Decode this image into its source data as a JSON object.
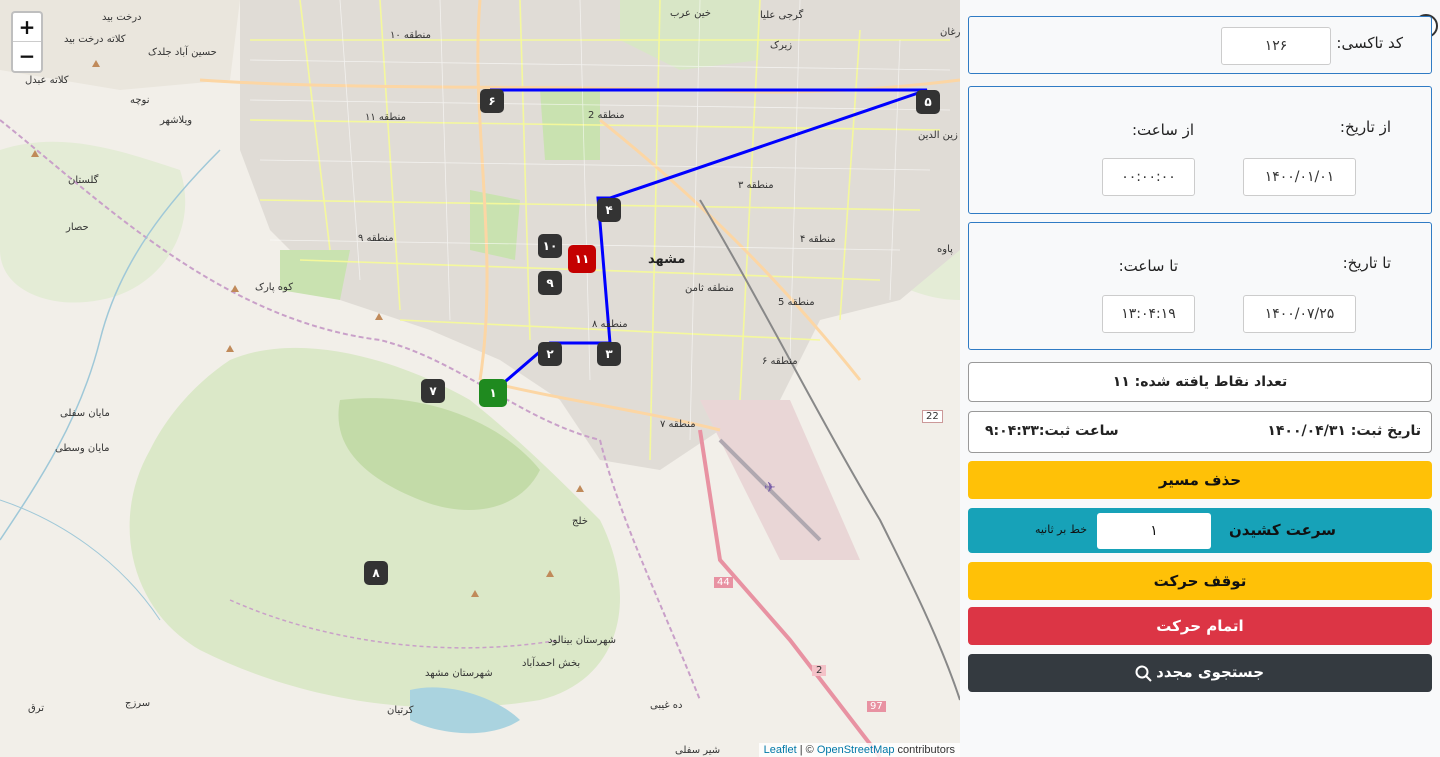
{
  "map": {
    "zoom_in_label": "+",
    "zoom_out_label": "−",
    "attribution": {
      "leaflet": "Leaflet",
      "separator": " | © ",
      "osm": "OpenStreetMap",
      "contributors": " contributors"
    },
    "labels": {
      "city": "مشهد",
      "d10": "منطقه ۱۰",
      "d2": "منطقه 2",
      "d11": "منطقه ۱۱",
      "d3": "منطقه ۳",
      "d4": "منطقه ۴",
      "d9": "منطقه ۹",
      "d5": "منطقه 5",
      "d6": "منطقه ۶",
      "d8": "منطقه ۸",
      "d7": "منطقه ۷",
      "thamen": "منطقه ثامن",
      "golestan": "گلستان",
      "hesar": "حصار",
      "kuhpark": "کوه پارک",
      "mayan_sofla": "مایان سفلی",
      "mayan_vosta": "مایان وسطی",
      "kalat": "کلاته عبدل",
      "vilashahr": "ویلاشهر",
      "noche": "نوچه",
      "khalaj": "خلج",
      "kartian": "کرتیان",
      "deh_ghibi": "ده غیبی",
      "sarzaj": "سرزج",
      "toroq": "ترق",
      "gorgi": "گرجی علیا",
      "zirak": "زیرک",
      "khin": "خین عرب",
      "zarghan": "زرغان",
      "zeinodin": "زین الدین",
      "pavia": "پاوه",
      "derakht_bid": "کلاته درخت بید",
      "hossein": "حسین آباد جلدک",
      "derakht": "درخت بید",
      "shir": "شیر سفلی",
      "toragh_r": "22",
      "hw44": "44",
      "hw2": "2",
      "hw97": "97",
      "binalud": "شهرستان بینالود",
      "ahmadabad": "بخش احمدآباد",
      "mashhad_county": "شهرستان مشهد"
    },
    "markers": [
      "۱",
      "۲",
      "۳",
      "۴",
      "۵",
      "۶",
      "۷",
      "۸",
      "۹",
      "۱۰",
      "۱۱"
    ]
  },
  "panel": {
    "taxi_code_label": "کد تاکسی:",
    "taxi_code_value": "۱۲۶",
    "from_date_label": "از تاریخ:",
    "from_time_label": "از ساعت:",
    "from_date_value": "۱۴۰۰/۰۱/۰۱",
    "from_time_value": "۰۰:۰۰:۰۰",
    "to_date_label": "تا تاریخ:",
    "to_time_label": "تا ساعت:",
    "to_date_value": "۱۴۰۰/۰۷/۲۵",
    "to_time_value": "۱۳:۰۴:۱۹",
    "points_found": "تعداد نقاط یافته شده: ۱۱",
    "reg_date": "تاریخ ثبت: ۱۴۰۰/۰۴/۳۱",
    "reg_time": "ساعت ثبت:۹:۰۴:۳۳",
    "delete_route": "حذف مسیر",
    "draw_speed_label": "سرعت کشیدن",
    "draw_speed_value": "۱",
    "draw_speed_unit": "خط بر ثانیه",
    "stop_motion": "توقف حرکت",
    "finish_motion": "اتمام حرکت",
    "search_again": "جستجوی مجدد"
  }
}
